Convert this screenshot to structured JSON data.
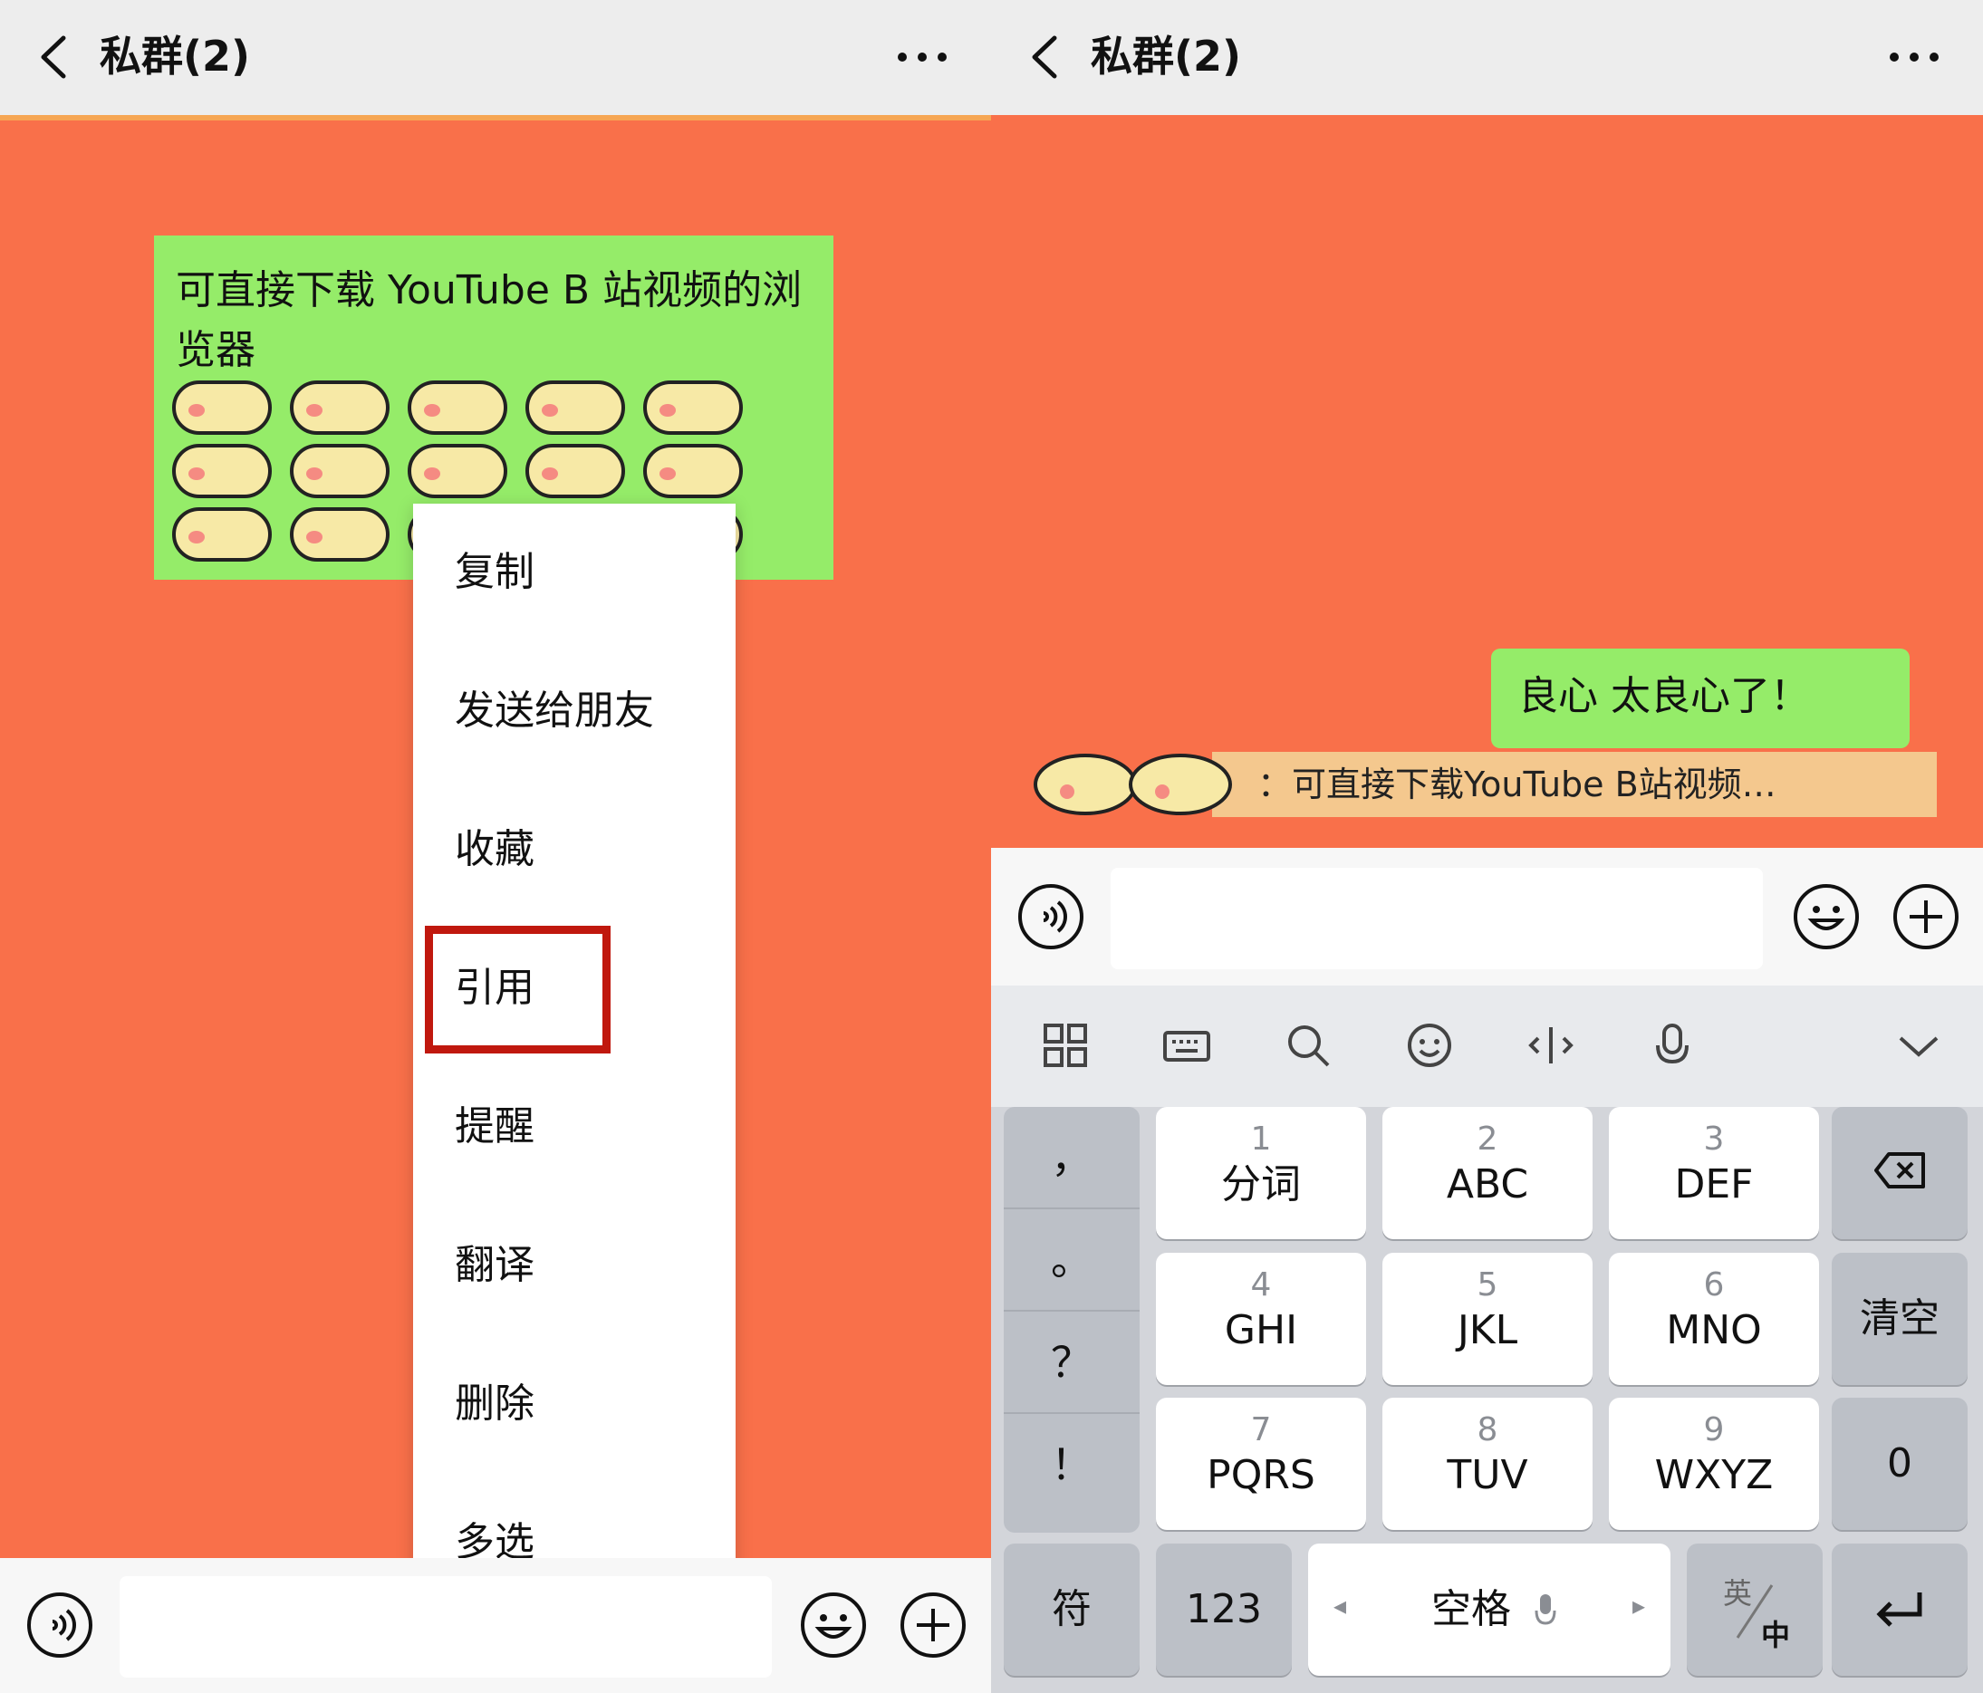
{
  "left": {
    "nav": {
      "title": "私群(2)"
    },
    "message": {
      "text": "可直接下载 YouTube B 站视频的浏览器"
    },
    "menu": {
      "items": [
        "复制",
        "发送给朋友",
        "收藏",
        "引用",
        "提醒",
        "翻译",
        "删除",
        "多选"
      ],
      "highlighted": "引用"
    }
  },
  "right": {
    "nav": {
      "title": "私群(2)"
    },
    "reply": {
      "text": "良心 太良心了！"
    },
    "quote": {
      "text": "：可直接下载YouTube B站视频…"
    },
    "keyboard": {
      "punctuation": [
        "，",
        "。",
        "？",
        "！"
      ],
      "keys": [
        {
          "num": "1",
          "letters": "分词"
        },
        {
          "num": "2",
          "letters": "ABC"
        },
        {
          "num": "3",
          "letters": "DEF"
        },
        {
          "num": "4",
          "letters": "GHI"
        },
        {
          "num": "5",
          "letters": "JKL"
        },
        {
          "num": "6",
          "letters": "MNO"
        },
        {
          "num": "7",
          "letters": "PQRS"
        },
        {
          "num": "8",
          "letters": "TUV"
        },
        {
          "num": "9",
          "letters": "WXYZ"
        }
      ],
      "clear_label": "清空",
      "zero_label": "0",
      "symbol_label": "符",
      "numeric_label": "123",
      "space_label": "空格",
      "lang_top": "英",
      "lang_bottom": "中"
    }
  },
  "colors": {
    "chat_background": "#f9704a",
    "bubble_green": "#95ec69",
    "highlight_red": "#c0180e",
    "nav_gray": "#ededed"
  },
  "icons": [
    "back-chevron-icon",
    "more-dots-icon",
    "voice-icon",
    "emoji-icon",
    "plus-icon",
    "grid-icon",
    "keyboard-icon",
    "search-icon",
    "smile-icon",
    "cursor-icon",
    "mic-icon",
    "collapse-chevron-icon",
    "backspace-icon",
    "enter-icon"
  ]
}
